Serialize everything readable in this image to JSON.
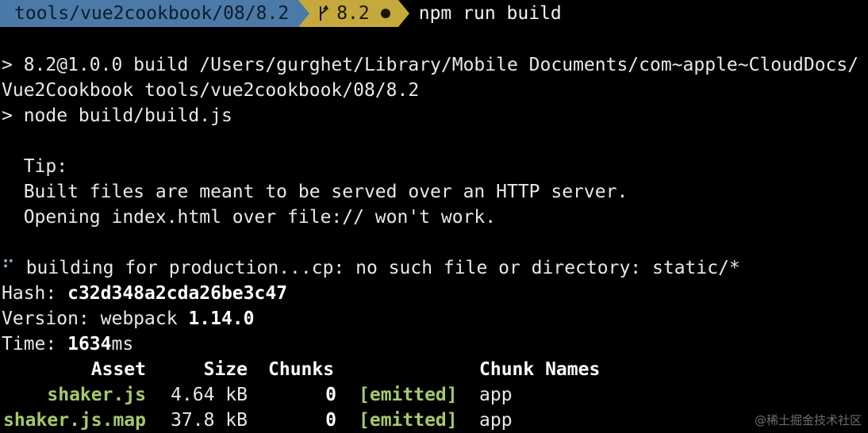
{
  "prompt": {
    "path": "tools/vue2cookbook/08/8.2",
    "branch": "8.2",
    "command": "npm run build"
  },
  "output": {
    "line1": "> 8.2@1.0.0 build /Users/gurghet/Library/Mobile Documents/com~apple~CloudDocs/",
    "line2": "Vue2Cookbook tools/vue2cookbook/08/8.2",
    "line3": "> node build/build.js",
    "tip_title": "  Tip:",
    "tip_line1": "  Built files are meant to be served over an HTTP server.",
    "tip_line2": "  Opening index.html over file:// won't work.",
    "spinner": "⠋",
    "building": " building for production...cp: no such file or directory: static/*",
    "hash_label": "Hash: ",
    "hash_value": "c32d348a2cda26be3c47",
    "version_label": "Version: webpack ",
    "version_value": "1.14.0",
    "time_label": "Time: ",
    "time_value": "1634",
    "time_unit": "ms"
  },
  "assets_table": {
    "headers": {
      "asset": "Asset",
      "size": "Size",
      "chunks": "Chunks",
      "chunk_names": "Chunk Names"
    },
    "rows": [
      {
        "asset": "shaker.js",
        "size": "4.64 kB",
        "chunks": "0",
        "status": "[emitted]",
        "chunk_name": "app"
      },
      {
        "asset": "shaker.js.map",
        "size": "37.8 kB",
        "chunks": "0",
        "status": "[emitted]",
        "chunk_name": "app"
      }
    ]
  },
  "watermark": "@稀土掘金技术社区",
  "colors": {
    "path_segment": "#4b7aa9",
    "branch_segment": "#c5a93c",
    "asset_green": "#a7c96a",
    "background": "#000000"
  }
}
